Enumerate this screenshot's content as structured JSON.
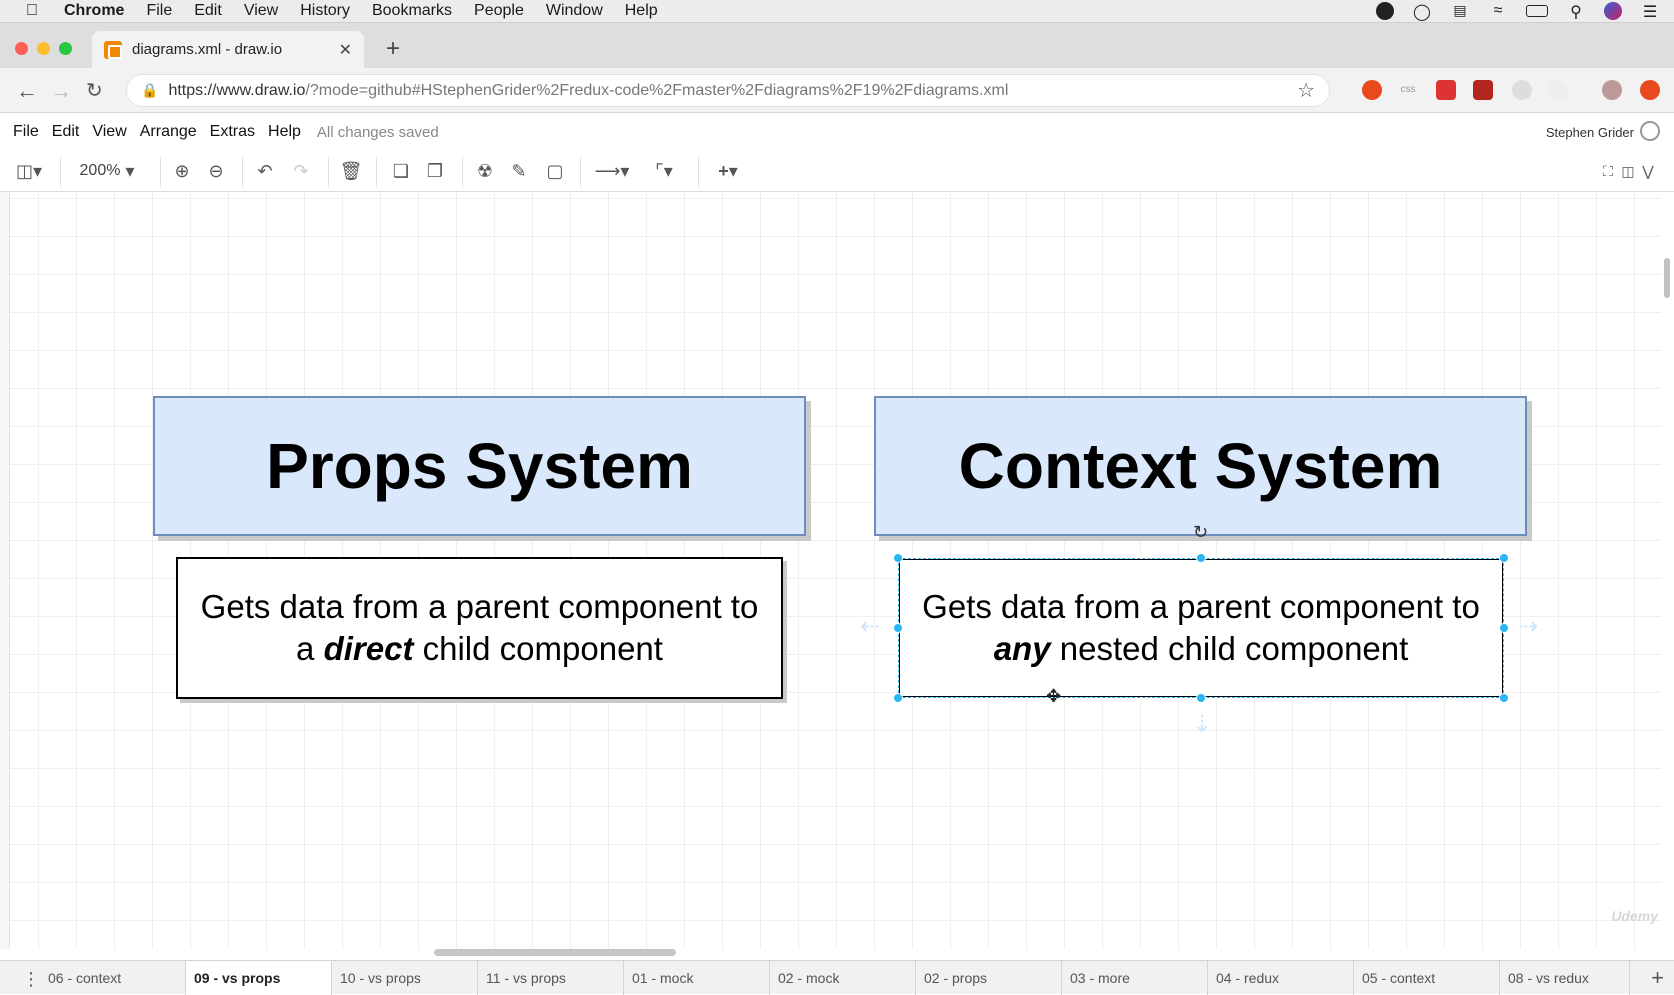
{
  "mac_menu": {
    "app": "Chrome",
    "items": [
      "File",
      "Edit",
      "View",
      "History",
      "Bookmarks",
      "People",
      "Window",
      "Help"
    ]
  },
  "browser": {
    "tab_title": "diagrams.xml - draw.io",
    "url_host": "https://www.draw.io",
    "url_rest": "/?mode=github#HStephenGrider%2Fredux-code%2Fmaster%2Fdiagrams%2F19%2Fdiagrams.xml"
  },
  "app_menu": {
    "items": [
      "File",
      "Edit",
      "View",
      "Arrange",
      "Extras",
      "Help"
    ],
    "status": "All changes saved",
    "user": "Stephen Grider"
  },
  "toolbar": {
    "zoom": "200%"
  },
  "diagram": {
    "left_header": "Props System",
    "right_header": "Context System",
    "left_desc_line1": "Gets data from a parent component to",
    "left_desc_pre": "a",
    "left_desc_emph": "direct",
    "left_desc_post": "child component",
    "right_desc_line1": "Gets data from a parent component to",
    "right_desc_emph": "any",
    "right_desc_post": "nested child component"
  },
  "page_tabs": [
    "06 - context",
    "09 - vs props",
    "10 - vs props",
    "11 - vs props",
    "01 - mock",
    "02 - mock",
    "02 - props",
    "03 - more",
    "04 - redux",
    "05 - context",
    "08 - vs redux"
  ],
  "active_page_tab": "09 - vs props",
  "watermark": "Udemy"
}
